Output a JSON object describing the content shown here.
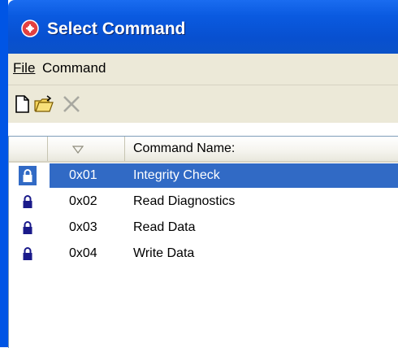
{
  "window": {
    "title": "Select Command",
    "colors": {
      "titlebar": "#0a5ae0",
      "selection": "#316ac5",
      "face": "#ece9d8",
      "lock": "#1a1a8a"
    }
  },
  "menubar": {
    "file_label": "File",
    "command_label": "Command"
  },
  "toolbar": {
    "new_icon": "new-document-icon",
    "open_icon": "open-folder-icon",
    "delete_icon": "delete-x-icon"
  },
  "list": {
    "headers": {
      "lock": "",
      "code": "",
      "name": "Command Name:"
    },
    "sort_icon": "sort-descending-icon",
    "rows": [
      {
        "code": "0x01",
        "name": "Integrity Check",
        "icon": "lock-icon",
        "selected": true
      },
      {
        "code": "0x02",
        "name": "Read Diagnostics",
        "icon": "lock-icon",
        "selected": false
      },
      {
        "code": "0x03",
        "name": "Read Data",
        "icon": "lock-icon",
        "selected": false
      },
      {
        "code": "0x04",
        "name": "Write Data",
        "icon": "lock-icon",
        "selected": false
      }
    ]
  }
}
